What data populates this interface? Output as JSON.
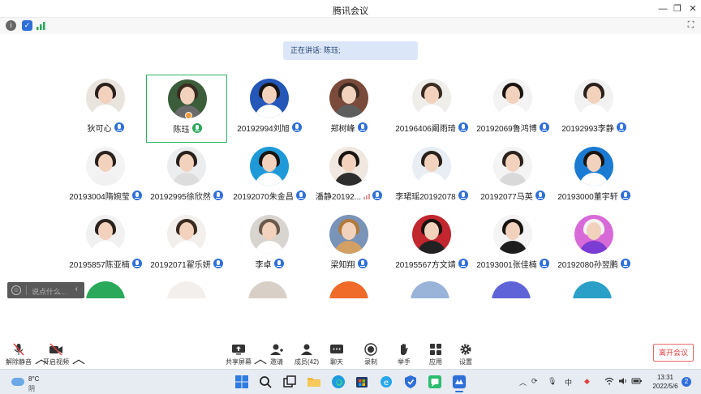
{
  "window": {
    "title": "腾讯会议"
  },
  "window_controls": {
    "minimize": "—",
    "maximize": "❐",
    "close": "✕",
    "fullscreen": "⛶"
  },
  "info_icons": [
    "info-icon",
    "shield-icon",
    "signal-icon"
  ],
  "speaking": {
    "text": "正在讲话: 陈珏;"
  },
  "participants": [
    {
      "name": "狄可心",
      "mic": "on"
    },
    {
      "name": "陈珏",
      "mic": "speaking",
      "active": true,
      "host": true
    },
    {
      "name": "20192994刘旭",
      "mic": "on"
    },
    {
      "name": "郑树峰",
      "mic": "on"
    },
    {
      "name": "20196406阚雨琦",
      "mic": "on"
    },
    {
      "name": "20192069鲁鸿博",
      "mic": "on"
    },
    {
      "name": "20192993李静",
      "mic": "on"
    },
    {
      "name": "20193004隋婉莹",
      "mic": "on"
    },
    {
      "name": "20192995徐欣然",
      "mic": "on"
    },
    {
      "name": "20192070朱金昌",
      "mic": "on"
    },
    {
      "name": "潘静20192...",
      "mic": "on",
      "signal": true
    },
    {
      "name": "李珺瑶20192078",
      "mic": "on"
    },
    {
      "name": "20192077马英",
      "mic": "on"
    },
    {
      "name": "20193000董宇轩",
      "mic": "on"
    },
    {
      "name": "20195857陈亚楠",
      "mic": "on"
    },
    {
      "name": "20192071翟乐妍",
      "mic": "on"
    },
    {
      "name": "李卓",
      "mic": "on"
    },
    {
      "name": "梁知翔",
      "mic": "on"
    },
    {
      "name": "20195567方文靖",
      "mic": "on"
    },
    {
      "name": "20193001张佳楠",
      "mic": "on"
    },
    {
      "name": "20192080孙翌鹏",
      "mic": "on"
    }
  ],
  "chat": {
    "placeholder": "说点什么...",
    "collapse": "‹"
  },
  "toolbar": {
    "unmute": "解除静音",
    "start_video": "开启视频",
    "share_screen": "共享屏幕",
    "invite": "邀请",
    "members": "成员(42)",
    "chat": "聊天",
    "record": "录制",
    "raise_hand": "举手",
    "apps": "应用",
    "settings": "设置",
    "leave": "离开会议"
  },
  "taskbar": {
    "temperature": "8°C",
    "weather": "阴",
    "time": "13:31",
    "date": "2022/5/6",
    "notifications": "2",
    "input_method": "中",
    "app_icons": [
      "windows-start-icon",
      "search-icon",
      "task-view-icon",
      "file-explorer-icon",
      "edge-icon",
      "store-icon",
      "ie-icon",
      "shield-app-icon",
      "lanxin-icon",
      "wechat-work-icon",
      "tencent-meeting-icon"
    ]
  },
  "colors": {
    "accent": "#2f6fd8",
    "speaking_bg": "#dbe7f9",
    "active_border": "#2bb25a",
    "leave": "#e04040"
  }
}
